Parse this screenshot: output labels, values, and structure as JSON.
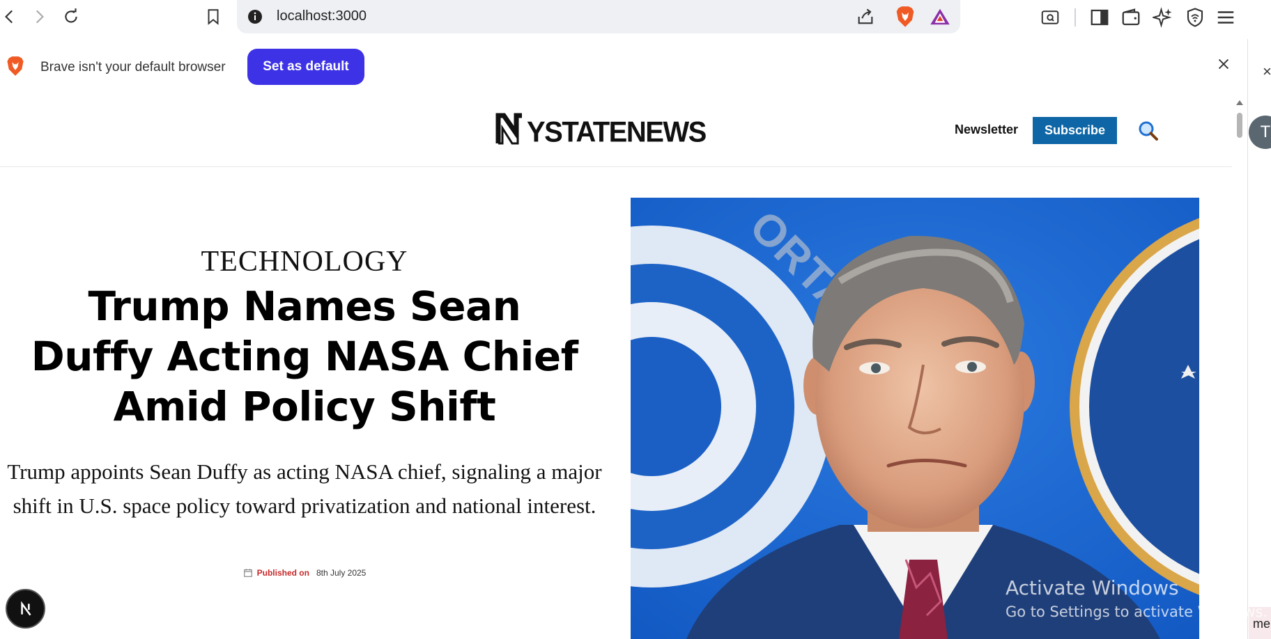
{
  "browser": {
    "url": "localhost:3000",
    "icons": [
      "back-icon",
      "forward-icon",
      "reload-icon",
      "bookmark-icon",
      "site-info-icon",
      "share-icon",
      "brave-shields-icon",
      "brave-rewards-icon",
      "reader-mode-icon",
      "sidebar-icon",
      "wallet-icon",
      "leo-ai-icon",
      "vpn-icon",
      "menu-icon"
    ]
  },
  "infobar": {
    "message": "Brave isn't your default browser",
    "button_label": "Set as default",
    "accent": "#3d32e6"
  },
  "site": {
    "logo_text": "YSTATENEWS",
    "logo_mark": "N",
    "newsletter_label": "Newsletter",
    "subscribe_label": "Subscribe",
    "subscribe_color": "#0e66a6"
  },
  "article": {
    "category": "TECHNOLOGY",
    "headline": "Trump Names Sean Duffy Acting NASA Chief Amid Policy Shift",
    "summary": "Trump appoints Sean Duffy as acting NASA chief, signaling a major shift in U.S. space policy toward privatization and national interest.",
    "published_label": "Published on",
    "published_date": "8th July 2025",
    "published_color": "#c62828"
  },
  "overlay": {
    "avatar_letter": "T",
    "next_badge_letter": "N",
    "edge_text": "me",
    "watermark_title": "Activate Windows",
    "watermark_sub": "Go to Settings to activate Windows."
  }
}
